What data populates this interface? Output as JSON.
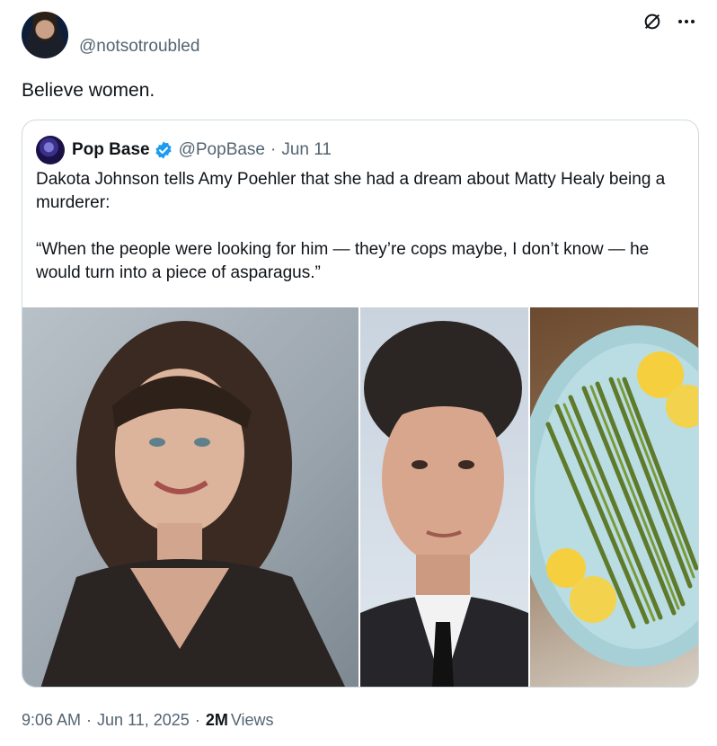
{
  "author": {
    "handle": "@notsotroubled",
    "text": "Believe women."
  },
  "quote": {
    "name": "Pop Base",
    "handle": "@PopBase",
    "separator": "·",
    "date": "Jun 11",
    "text": "Dakota Johnson tells Amy Poehler that she had a dream about Matty Healy being a murderer:\n\n“When the people were looking for him — they’re cops maybe, I don’t know — he would turn into a piece of asparagus.”",
    "verified_color": "#1d9bf0"
  },
  "footer": {
    "time": "9:06 AM",
    "separator": "·",
    "date": "Jun 11, 2025",
    "separator2": "·",
    "views_count": "2M",
    "views_label": "Views"
  },
  "icons": {
    "top_left": "grok-icon",
    "top_right": "more-options-icon"
  },
  "colors": {
    "text_primary": "#0f1419",
    "text_secondary": "#536471",
    "border": "#cfd9de"
  }
}
